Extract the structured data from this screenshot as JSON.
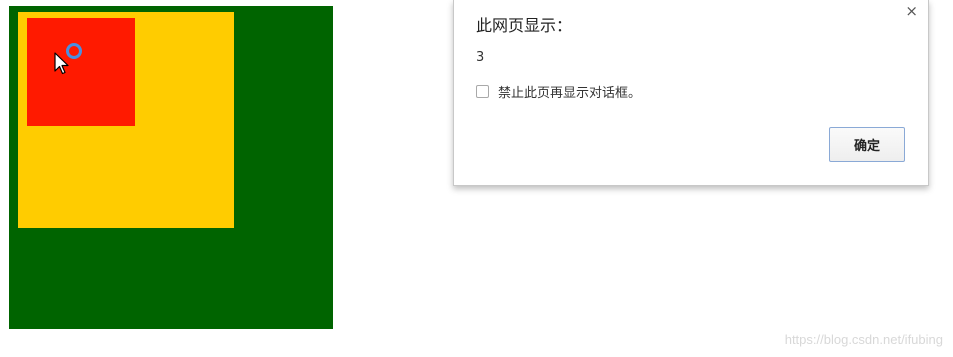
{
  "boxes": {
    "outer_color": "#006400",
    "middle_color": "#ffcc00",
    "inner_color": "#ff1a00"
  },
  "cursor": {
    "icon": "arrow-cursor-icon",
    "click_indicator": "click-ring-icon",
    "click_color": "#4a8fe0"
  },
  "dialog": {
    "title": "此网页显示：",
    "close_label": "×",
    "message": "3",
    "checkbox_label": "禁止此页再显示对话框。",
    "checkbox_checked": false,
    "ok_label": "确定"
  },
  "watermark": {
    "text": "https://blog.csdn.net/ifubing"
  }
}
